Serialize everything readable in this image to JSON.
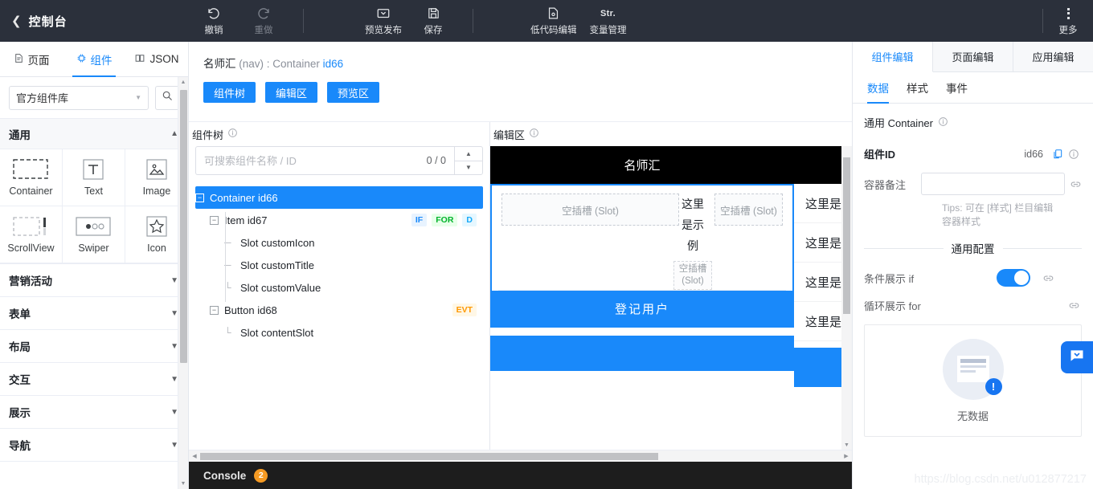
{
  "topbar": {
    "back_title": "控制台",
    "tools": [
      {
        "label": "撤销",
        "icon": "undo-icon",
        "disabled": false
      },
      {
        "label": "重做",
        "icon": "redo-icon",
        "disabled": true
      },
      {
        "label": "预览发布",
        "icon": "preview-publish-icon",
        "disabled": false
      },
      {
        "label": "保存",
        "icon": "save-disk-icon",
        "disabled": false
      },
      {
        "label": "低代码编辑",
        "icon": "lowcode-file-icon",
        "disabled": false
      },
      {
        "label": "变量管理",
        "icon": "str-variable-icon",
        "disabled": false
      }
    ],
    "more_label": "更多"
  },
  "left_panel": {
    "tabs": [
      {
        "label": "页面",
        "icon": "page-icon",
        "active": false
      },
      {
        "label": "组件",
        "icon": "component-chip-icon",
        "active": true
      },
      {
        "label": "JSON",
        "icon": "json-book-icon",
        "active": false
      }
    ],
    "library_select": "官方组件库",
    "search_icon": "search-icon",
    "section_general": "通用",
    "components": [
      {
        "label": "Container",
        "icon": "dashed-rect-icon"
      },
      {
        "label": "Text",
        "icon": "text-t-icon"
      },
      {
        "label": "Image",
        "icon": "image-icon"
      },
      {
        "label": "ScrollView",
        "icon": "scrollview-icon"
      },
      {
        "label": "Swiper",
        "icon": "swiper-dots-icon"
      },
      {
        "label": "Icon",
        "icon": "star-icon"
      }
    ],
    "categories": [
      {
        "label": "营销活动"
      },
      {
        "label": "表单"
      },
      {
        "label": "布局"
      },
      {
        "label": "交互"
      },
      {
        "label": "展示"
      },
      {
        "label": "导航"
      }
    ]
  },
  "center": {
    "breadcrumb": {
      "name": "名师汇",
      "type": "(nav) :",
      "component": "Container",
      "id": "id66"
    },
    "nav_buttons": [
      "组件树",
      "编辑区",
      "预览区"
    ],
    "tree_pane": {
      "header": "组件树",
      "search_placeholder": "可搜索组件名称 / ID",
      "search_value": "",
      "match_count": "0 / 0",
      "nodes": [
        {
          "label": "Container id66",
          "level": 0,
          "selected": true,
          "expandable": true,
          "badges": []
        },
        {
          "label": "Item id67",
          "level": 1,
          "selected": false,
          "expandable": true,
          "badges": [
            "IF",
            "FOR",
            "D"
          ]
        },
        {
          "label": "Slot customIcon",
          "level": 2,
          "selected": false,
          "expandable": false,
          "badges": []
        },
        {
          "label": "Slot customTitle",
          "level": 2,
          "selected": false,
          "expandable": false,
          "badges": []
        },
        {
          "label": "Slot customValue",
          "level": 2,
          "selected": false,
          "expandable": false,
          "badges": []
        },
        {
          "label": "Button id68",
          "level": 1,
          "selected": false,
          "expandable": true,
          "badges": [
            "EVT"
          ]
        },
        {
          "label": "Slot contentSlot",
          "level": 2,
          "selected": false,
          "expandable": false,
          "badges": []
        }
      ]
    },
    "editor_pane": {
      "header": "编辑区",
      "nav_title": "名师汇",
      "slot_a": "空插槽 (Slot)",
      "slot_b": "空插槽 (Slot)",
      "slot_c": "空插槽 (Slot)",
      "sample_text": "这里是示例",
      "button_label": "登记用户"
    },
    "preview_pane": {
      "header": "预览区",
      "rows": [
        "这里是",
        "这里是",
        "这里是",
        "这里是"
      ]
    },
    "console": {
      "label": "Console",
      "badge": "2"
    }
  },
  "right_panel": {
    "tabs": [
      {
        "label": "组件编辑",
        "active": true
      },
      {
        "label": "页面编辑",
        "active": false
      },
      {
        "label": "应用编辑",
        "active": false
      }
    ],
    "subtabs": [
      {
        "label": "数据",
        "active": true
      },
      {
        "label": "样式",
        "active": false
      },
      {
        "label": "事件",
        "active": false
      }
    ],
    "component_type": "通用 Container",
    "fields": {
      "id_label": "组件ID",
      "id_value": "id66",
      "remark_label": "容器备注",
      "remark_value": "",
      "tips": "Tips: 可在 [样式] 栏目编辑容器样式",
      "section_title": "通用配置",
      "if_label": "条件展示 if",
      "if_on": true,
      "for_label": "循环展示 for"
    },
    "empty_state": {
      "text": "无数据",
      "badge": "!"
    },
    "chat_icon": "chat-bubble-icon"
  },
  "watermark": "https://blog.csdn.net/u012877217",
  "colors": {
    "accent": "#1989fa",
    "topbar": "#2b303b",
    "console": "#1d1d1d",
    "badge_orange": "#f59a23"
  }
}
